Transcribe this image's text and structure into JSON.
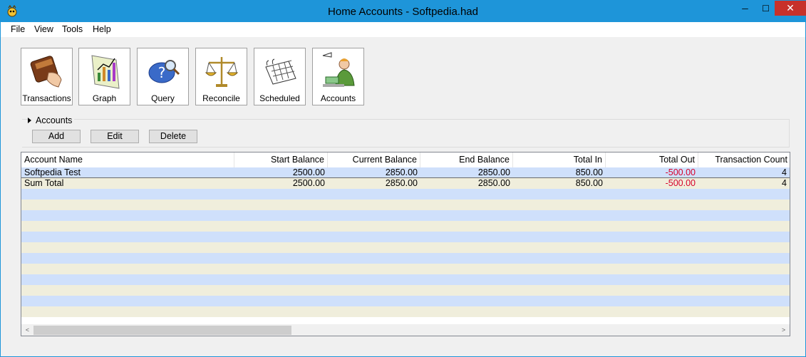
{
  "window": {
    "title": "Home Accounts - Softpedia.had",
    "minimize": "─",
    "maximize": "☐",
    "close": "✕"
  },
  "menu": [
    "File",
    "View",
    "Tools",
    "Help"
  ],
  "toolbar": [
    "Transactions",
    "Graph",
    "Query",
    "Reconcile",
    "Scheduled",
    "Accounts"
  ],
  "accounts_group": {
    "caption": "Accounts",
    "add": "Add",
    "edit": "Edit",
    "delete": "Delete"
  },
  "table": {
    "columns": [
      "Account Name",
      "Start Balance",
      "Current Balance",
      "End Balance",
      "Total In",
      "Total Out",
      "Transaction Count"
    ],
    "rows": [
      [
        "Softpedia Test",
        "2500.00",
        "2850.00",
        "2850.00",
        "850.00",
        "-500.00",
        "4"
      ],
      [
        "Sum Total",
        "2500.00",
        "2850.00",
        "2850.00",
        "850.00",
        "-500.00",
        "4"
      ]
    ]
  },
  "scrollbar": {
    "left": "<",
    "right": ">"
  },
  "colors": {
    "titlebar": "#1e95d9",
    "close": "#c7312a",
    "negative": "#d6002a",
    "row_blue": "#cfe0fb",
    "row_cream": "#f0eedc"
  }
}
